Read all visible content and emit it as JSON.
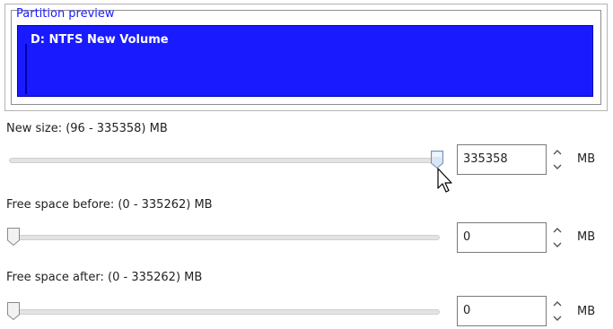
{
  "preview": {
    "title": "Partition preview",
    "partition_label": "D: NTFS New Volume",
    "partition_color": "#1a1aff"
  },
  "new_size": {
    "label": "New size: (96 - 335358) MB",
    "value": "335358",
    "unit": "MB",
    "slider_position": 1.0
  },
  "free_before": {
    "label": "Free space before: (0 - 335262) MB",
    "value": "0",
    "unit": "MB",
    "slider_position": 0.0
  },
  "free_after": {
    "label": "Free space after: (0 - 335262) MB",
    "value": "0",
    "unit": "MB",
    "slider_position": 0.0
  },
  "icons": {
    "spin_up": "chevron-up-icon",
    "spin_down": "chevron-down-icon",
    "pointer": "mouse-pointer-icon"
  }
}
